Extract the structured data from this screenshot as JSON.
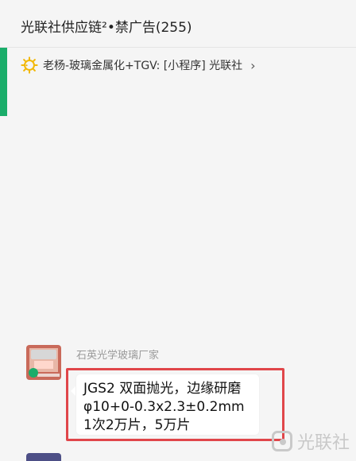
{
  "header": {
    "title": "光联社供应链²•禁广告(255)"
  },
  "notice": {
    "icon": "sun-icon",
    "text": "老杨-玻璃金属化+TGV: [小程序] 光联社",
    "chevron": "›"
  },
  "message": {
    "sender": "石英光学玻璃厂家",
    "lines": [
      "JGS2 双面抛光，边缘研磨",
      "φ10+0-0.3x2.3±0.2mm",
      "1次2万片，5万片"
    ]
  },
  "watermark": {
    "text": "光联社"
  },
  "colors": {
    "accent": "#1aad6a",
    "highlight": "#e0464a",
    "background": "#f5f5f5",
    "bubble": "#ffffff"
  }
}
